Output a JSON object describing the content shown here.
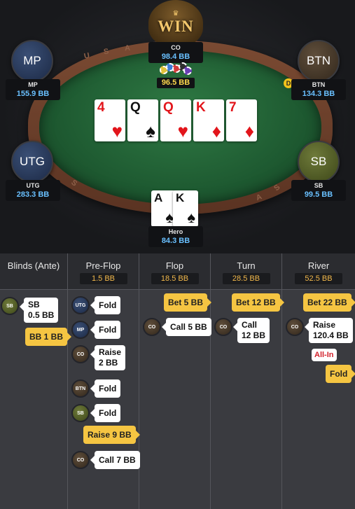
{
  "table": {
    "rail_letters": [
      "U",
      "S",
      "A",
      "S",
      "A",
      "S"
    ],
    "win_label": "WIN",
    "pot": "96.5 BB",
    "dealer_label": "D",
    "players": {
      "co": {
        "pos": "CO",
        "stack": "98.4 BB"
      },
      "mp": {
        "avatar": "MP",
        "pos": "MP",
        "stack": "155.9 BB"
      },
      "btn": {
        "avatar": "BTN",
        "pos": "BTN",
        "stack": "134.3 BB"
      },
      "utg": {
        "avatar": "UTG",
        "pos": "UTG",
        "stack": "283.3 BB"
      },
      "sb": {
        "avatar": "SB",
        "pos": "SB",
        "stack": "99.5 BB"
      },
      "hero": {
        "pos": "Hero",
        "stack": "84.3 BB"
      }
    },
    "board": [
      {
        "rank": "4",
        "suit": "♥",
        "color": "red"
      },
      {
        "rank": "Q",
        "suit": "♠",
        "color": "black"
      },
      {
        "rank": "Q",
        "suit": "♥",
        "color": "red"
      },
      {
        "rank": "K",
        "suit": "♦",
        "color": "red"
      },
      {
        "rank": "7",
        "suit": "♦",
        "color": "red"
      }
    ],
    "hero_cards": [
      {
        "rank": "A",
        "suit": "♠",
        "color": "black"
      },
      {
        "rank": "K",
        "suit": "♠",
        "color": "black"
      }
    ]
  },
  "streets": {
    "blinds": {
      "title": "Blinds (Ante)"
    },
    "preflop": {
      "title": "Pre-Flop",
      "pot": "1.5 BB"
    },
    "flop": {
      "title": "Flop",
      "pot": "18.5 BB"
    },
    "turn": {
      "title": "Turn",
      "pot": "28.5 BB"
    },
    "river": {
      "title": "River",
      "pot": "52.5 BB"
    }
  },
  "actions": {
    "blinds": {
      "sb_chip": "SB",
      "sb_post_1": "SB",
      "sb_post_2": "0.5 BB",
      "bb_post": "BB 1 BB"
    },
    "preflop": {
      "utg_chip": "UTG",
      "utg": "Fold",
      "mp_chip": "MP",
      "mp": "Fold",
      "co_chip": "CO",
      "co_raise_1": "Raise",
      "co_raise_2": "2 BB",
      "btn_chip": "BTN",
      "btn": "Fold",
      "sb_chip": "SB",
      "sb": "Fold",
      "hero_raise": "Raise 9 BB",
      "co_call_chip": "CO",
      "co_call": "Call 7 BB"
    },
    "flop": {
      "hero_bet": "Bet 5 BB",
      "co_chip": "CO",
      "co_call": "Call 5 BB"
    },
    "turn": {
      "hero_bet": "Bet 12 BB",
      "co_chip": "CO",
      "co_call_1": "Call",
      "co_call_2": "12 BB"
    },
    "river": {
      "hero_bet": "Bet 22 BB",
      "co_chip": "CO",
      "co_raise_1": "Raise",
      "co_raise_2": "120.4 BB",
      "allin": "All-In",
      "hero_fold": "Fold"
    }
  }
}
